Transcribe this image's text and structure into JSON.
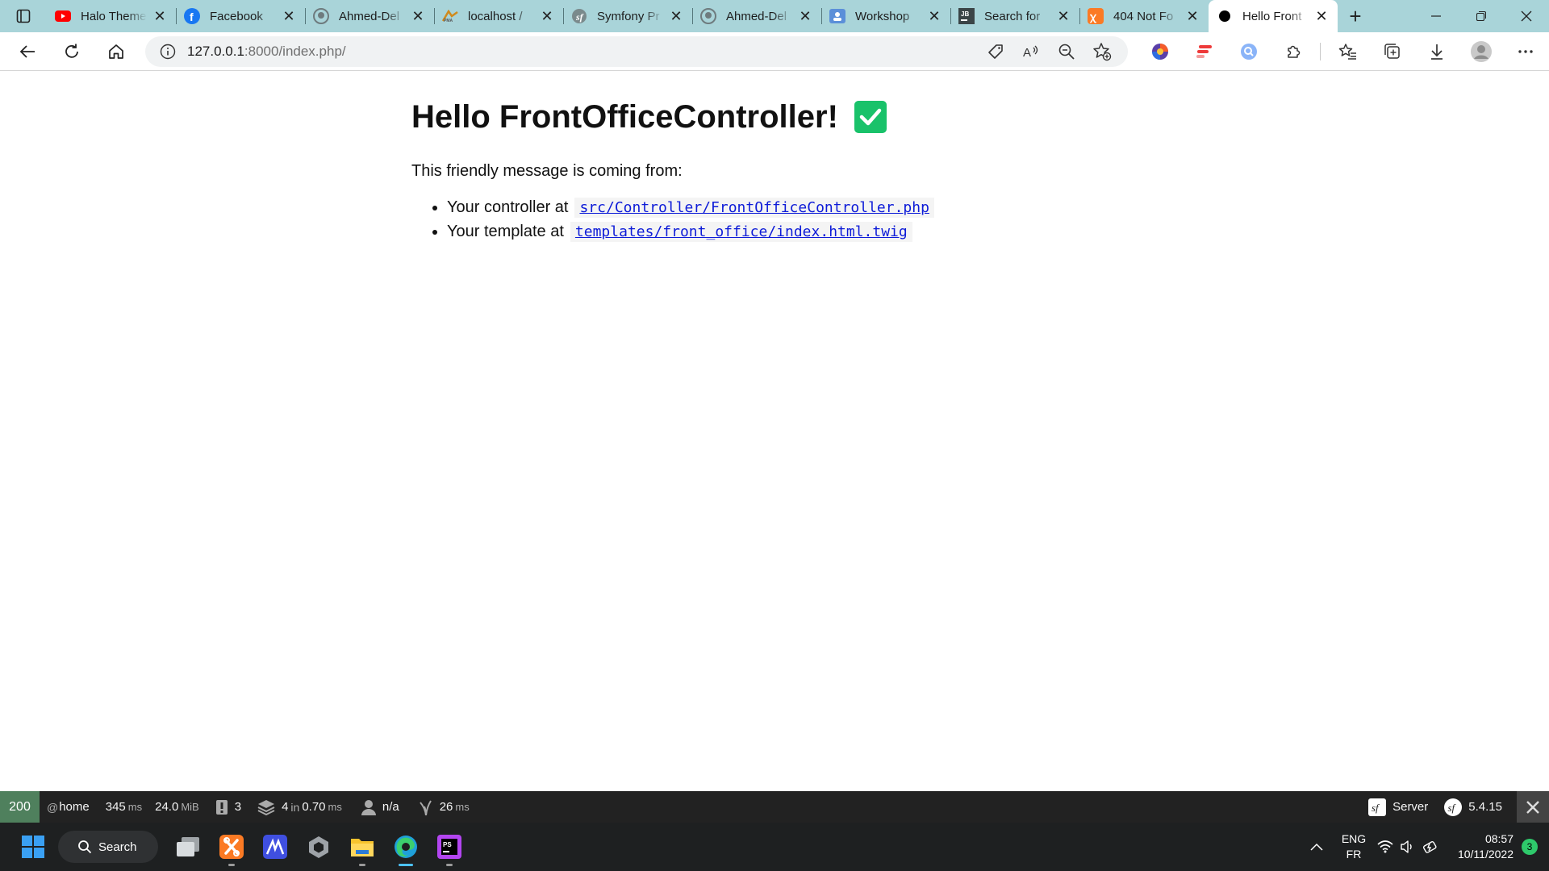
{
  "browser": {
    "tabs": [
      {
        "title": "Halo Theme",
        "icon": "youtube-icon"
      },
      {
        "title": "Facebook",
        "icon": "facebook-icon"
      },
      {
        "title": "Ahmed-Del",
        "icon": "github-icon"
      },
      {
        "title": "localhost /",
        "icon": "phpmyadmin-icon"
      },
      {
        "title": "Symfony Pr",
        "icon": "symfony-icon"
      },
      {
        "title": "Ahmed-Del",
        "icon": "github-icon"
      },
      {
        "title": "Workshop",
        "icon": "profile-icon"
      },
      {
        "title": "Search for",
        "icon": "jetbrains-icon"
      },
      {
        "title": "404 Not Fo",
        "icon": "xampp-icon"
      },
      {
        "title": "Hello Front",
        "icon": "dot-icon",
        "active": true
      }
    ],
    "url_host": "127.0.0.1",
    "url_rest": ":8000/index.php/"
  },
  "page": {
    "heading": "Hello FrontOfficeController!",
    "intro": "This friendly message is coming from:",
    "controller_label": "Your controller at",
    "controller_path": "src/Controller/FrontOfficeController.php",
    "template_label": "Your template at",
    "template_path": "templates/front_office/index.html.twig"
  },
  "debug_toolbar": {
    "status_code": "200",
    "route_prefix": "@",
    "route": "home",
    "time_value": "345",
    "time_unit": "ms",
    "memory_value": "24.0",
    "memory_unit": "MiB",
    "forms_count": "3",
    "cache_calls": "4",
    "cache_in": "in",
    "cache_time": "0.70",
    "cache_unit": "ms",
    "user": "n/a",
    "twig_time": "26",
    "twig_unit": "ms",
    "server_label": "Server",
    "symfony_version": "5.4.15",
    "status_color": "#4f805d"
  },
  "taskbar": {
    "search_label": "Search",
    "lang_primary": "ENG",
    "lang_secondary": "FR",
    "time": "08:57",
    "date": "10/11/2022",
    "notification_count": "3"
  }
}
